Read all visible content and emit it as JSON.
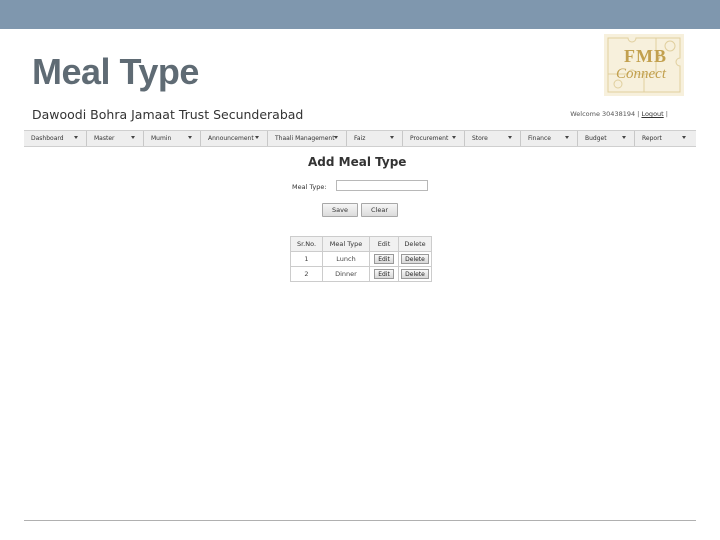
{
  "slide": {
    "title": "Meal Type",
    "header_color": "#7f97ae"
  },
  "logo": {
    "line1": "FMB",
    "line2": "Connect"
  },
  "app": {
    "title": "Dawoodi Bohra Jamaat Trust Secunderabad",
    "welcome_text": "Welcome 30438194 |",
    "logout_label": "Logout",
    "welcome_suffix": "|"
  },
  "menu": [
    {
      "label": "Dashboard"
    },
    {
      "label": "Master"
    },
    {
      "label": "Mumin"
    },
    {
      "label": "Announcement"
    },
    {
      "label": "Thaali Management"
    },
    {
      "label": "Faiz"
    },
    {
      "label": "Procurement"
    },
    {
      "label": "Store"
    },
    {
      "label": "Finance"
    },
    {
      "label": "Budget"
    },
    {
      "label": "Report"
    }
  ],
  "form": {
    "heading": "Add Meal Type",
    "meal_type_label": "Meal Type:",
    "meal_type_value": "",
    "save_label": "Save",
    "clear_label": "Clear"
  },
  "table": {
    "headers": [
      "Sr.No.",
      "Meal Type",
      "Edit",
      "Delete"
    ],
    "rows": [
      {
        "sr": "1",
        "meal_type": "Lunch",
        "edit": "Edit",
        "delete": "Delete"
      },
      {
        "sr": "2",
        "meal_type": "Dinner",
        "edit": "Edit",
        "delete": "Delete"
      }
    ]
  }
}
